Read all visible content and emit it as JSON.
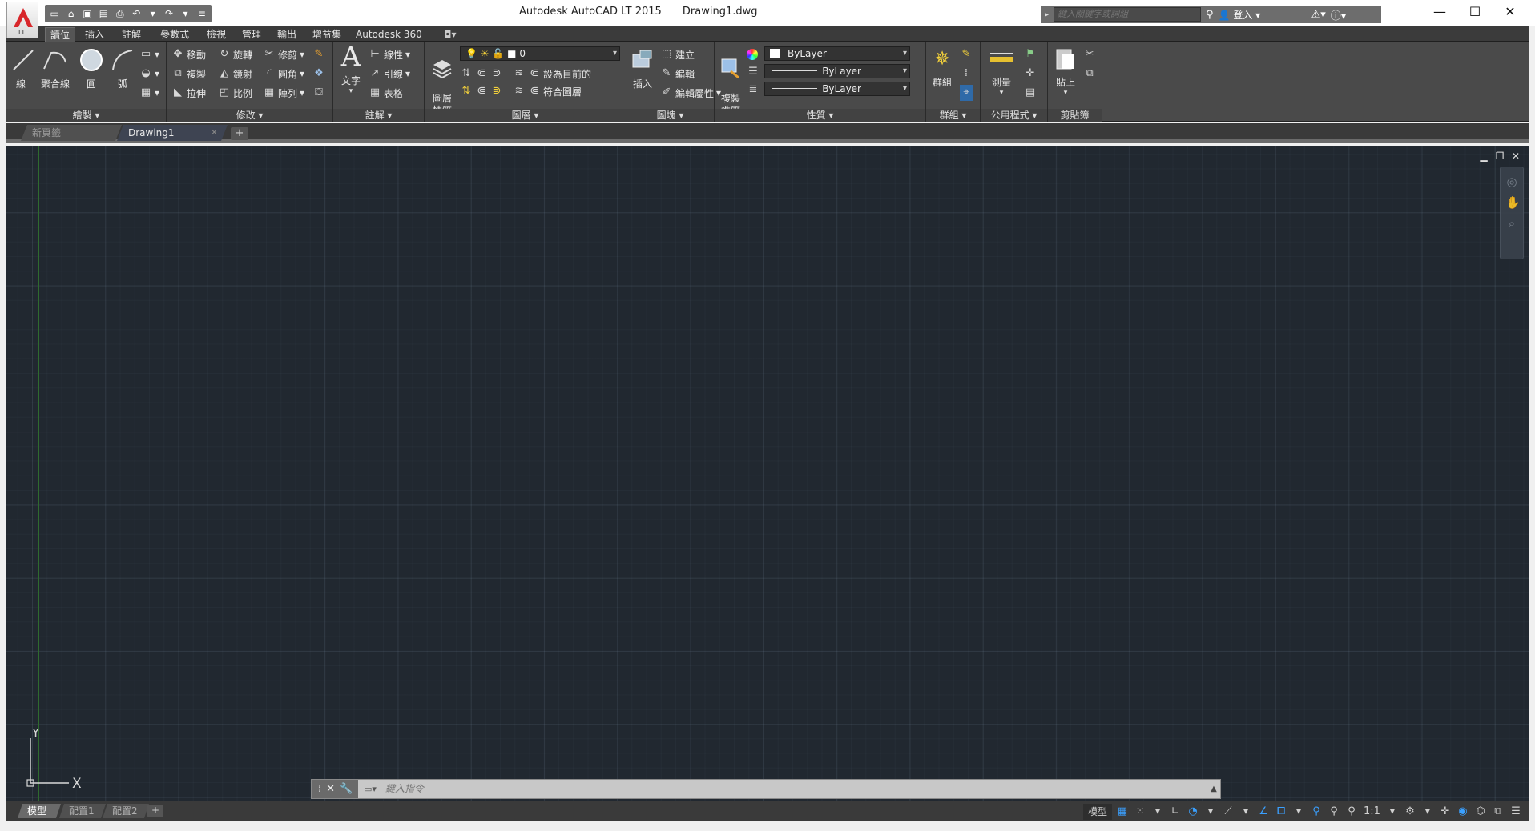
{
  "titlebar": {
    "app_name": "Autodesk AutoCAD LT 2015",
    "document": "Drawing1.dwg",
    "app_badge": "LT",
    "search_placeholder": "鍵入關鍵字或詞組",
    "signin_label": "登入",
    "help_icon": "help-icon"
  },
  "ribbon_tabs": [
    "讀位",
    "插入",
    "註解",
    "參數式",
    "檢視",
    "管理",
    "輸出",
    "增益集",
    "Autodesk 360"
  ],
  "active_ribbon_tab": "讀位",
  "draw_panel": {
    "title": "繪製",
    "line": "線",
    "polyline": "聚合線",
    "circle": "圓",
    "arc": "弧"
  },
  "modify_panel": {
    "title": "修改",
    "move": "移動",
    "rotate": "旋轉",
    "trim": "修剪",
    "copy": "複製",
    "mirror": "鏡射",
    "fillet": "圓角",
    "stretch": "拉伸",
    "scale": "比例",
    "array": "陣列"
  },
  "annotation_panel": {
    "title": "註解",
    "text": "文字",
    "linear": "線性",
    "leader": "引線",
    "table": "表格"
  },
  "layers_panel": {
    "title": "圖層",
    "layer_properties": "圖層\n性質",
    "current_layer": "0",
    "set_current": "設為目前的",
    "match_layer": "符合圖層"
  },
  "block_panel": {
    "title": "圖塊",
    "insert": "插入",
    "create": "建立",
    "edit": "編輯",
    "edit_attributes": "編輯屬性"
  },
  "properties_panel": {
    "title": "性質",
    "match_properties": "複製\n性質",
    "color": "ByLayer",
    "linetype": "ByLayer",
    "lineweight": "ByLayer"
  },
  "groups_panel": {
    "title": "群組",
    "group": "群組"
  },
  "utilities_panel": {
    "title": "公用程式",
    "measure": "測量"
  },
  "clipboard_panel": {
    "title": "剪貼簿",
    "paste": "貼上"
  },
  "file_tabs": {
    "start": "新頁籤",
    "drawing": "Drawing1",
    "add": "+"
  },
  "ucs": {
    "x_label": "X",
    "y_label": "Y"
  },
  "command_line": {
    "placeholder": "鍵入指令"
  },
  "layout_tabs": [
    "模型",
    "配置1",
    "配置2"
  ],
  "active_layout_tab": "模型",
  "status": {
    "model_label": "模型",
    "annotation_scale": "1:1"
  },
  "colors": {
    "canvas_bg": "#212830",
    "ribbon_bg": "#4a4a4a",
    "accent_blue": "#3aa0ff"
  }
}
